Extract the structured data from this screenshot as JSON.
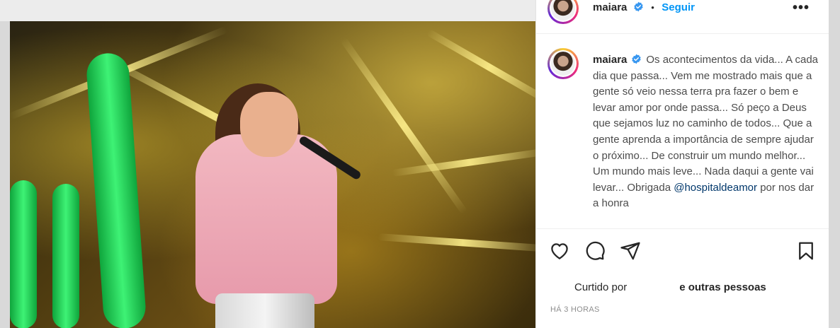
{
  "post": {
    "author": {
      "username": "maiara",
      "verified": true,
      "follow_label": "Seguir"
    },
    "more_label": "•••",
    "caption": {
      "text": "Os acontecimentos da vida... A cada dia que passa... Vem me mostrado mais que a gente só veio nessa terra pra fazer o bem e levar amor por onde passa... Só peço a Deus que sejamos luz no caminho de todos... Que a gente aprenda a importância de sempre ajudar o próximo... De construir um mundo melhor... Um mundo mais leve... Nada daqui a gente vai levar... Obrigada ",
      "mention": "@hospitaldeamor",
      "text_after": " por nos dar a honra"
    },
    "likes": {
      "prefix": "Curtido por",
      "suffix_bold": "e outras pessoas"
    },
    "timestamp": "HÁ 3 HORAS"
  },
  "icons": {
    "like": "heart-icon",
    "comment": "comment-icon",
    "share": "paper-plane-icon",
    "save": "bookmark-icon",
    "verified": "verified-badge-icon"
  },
  "colors": {
    "follow": "#0095f6",
    "verified": "#3897f0",
    "mention": "#00376b"
  }
}
